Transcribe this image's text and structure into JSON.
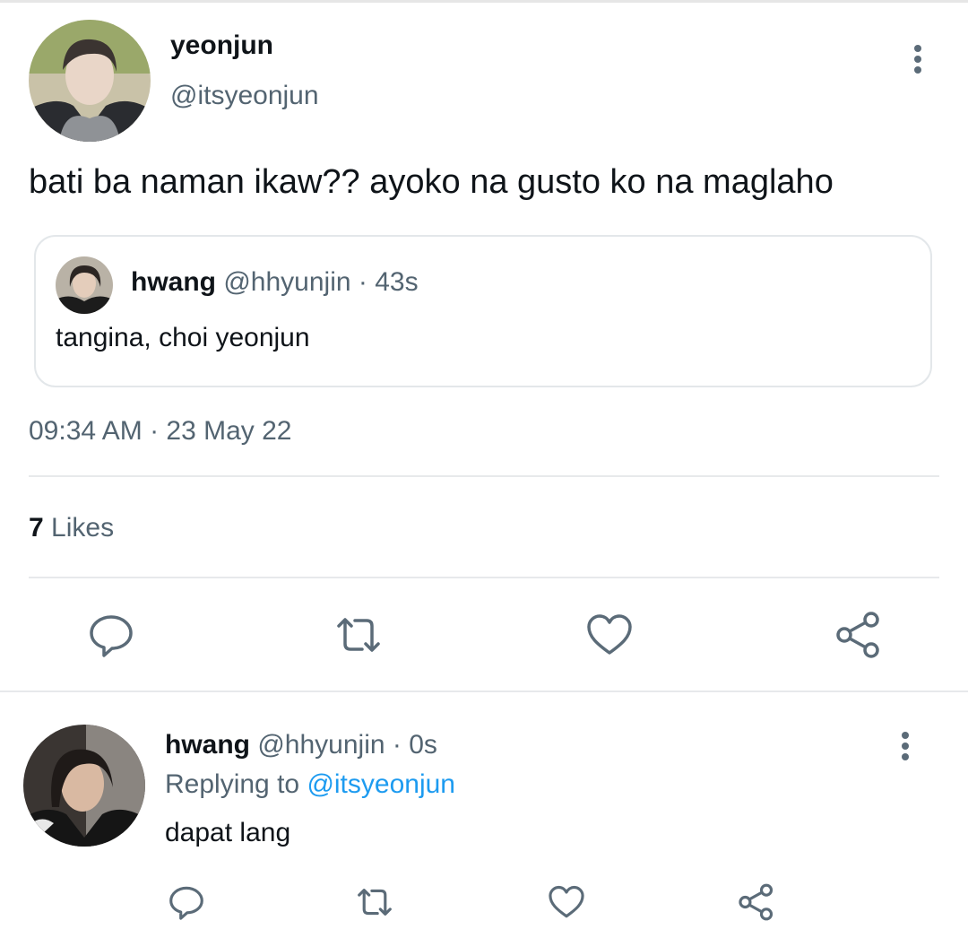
{
  "tweet": {
    "author": {
      "name": "yeonjun",
      "handle": "@itsyeonjun"
    },
    "text": "bati ba naman ikaw?? ayoko na gusto ko na maglaho",
    "quote": {
      "name": "hwang",
      "handle": "@hhyunjin",
      "separator": "·",
      "time": "43s",
      "text": "tangina, choi yeonjun"
    },
    "timestamp": "09:34 AM · 23 May 22",
    "likes": {
      "count": "7",
      "label": "Likes"
    },
    "actions": [
      "reply-icon",
      "retweet-icon",
      "like-icon",
      "share-icon"
    ]
  },
  "reply": {
    "name": "hwang",
    "handle": "@hhyunjin",
    "separator": "·",
    "time": "0s",
    "replying_label": "Replying to",
    "replying_to": "@itsyeonjun",
    "text": "dapat lang",
    "actions": [
      "reply-icon",
      "retweet-icon",
      "like-icon",
      "share-icon"
    ]
  },
  "colors": {
    "text_primary": "#0f1419",
    "text_secondary": "#536471",
    "icon_gray": "#5b6b78",
    "link_blue": "#1d9bf0",
    "divider": "#e7e9eb"
  }
}
